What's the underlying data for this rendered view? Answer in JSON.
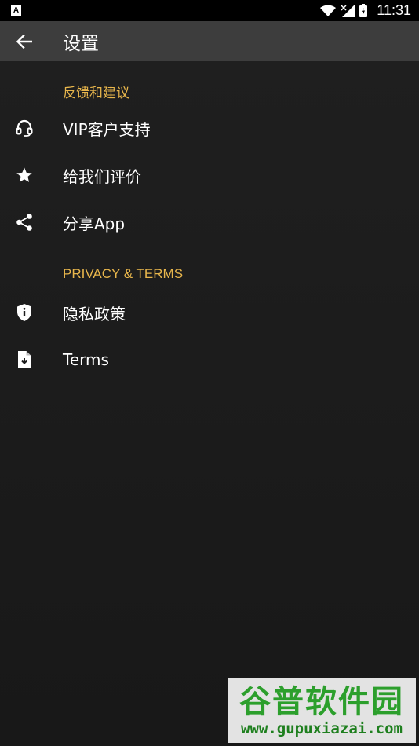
{
  "status_bar": {
    "app_icon_letter": "A",
    "time": "11:31"
  },
  "app_bar": {
    "title": "设置",
    "back_icon": "arrow-left-icon"
  },
  "sections": [
    {
      "header": "反馈和建议",
      "items": [
        {
          "label": "VIP客户支持",
          "icon": "headset-icon"
        },
        {
          "label": "给我们评价",
          "icon": "star-icon"
        },
        {
          "label": "分享App",
          "icon": "share-icon"
        }
      ]
    },
    {
      "header": "PRIVACY & TERMS",
      "items": [
        {
          "label": "隐私政策",
          "icon": "shield-info-icon"
        },
        {
          "label": "Terms",
          "icon": "document-icon"
        }
      ]
    }
  ],
  "watermark": {
    "title": "谷普软件园",
    "url": "www.gupuxiazai.com"
  },
  "colors": {
    "accent": "#e8b64c",
    "app_bar": "#3d3d3d",
    "background": "#1c1c1c"
  }
}
